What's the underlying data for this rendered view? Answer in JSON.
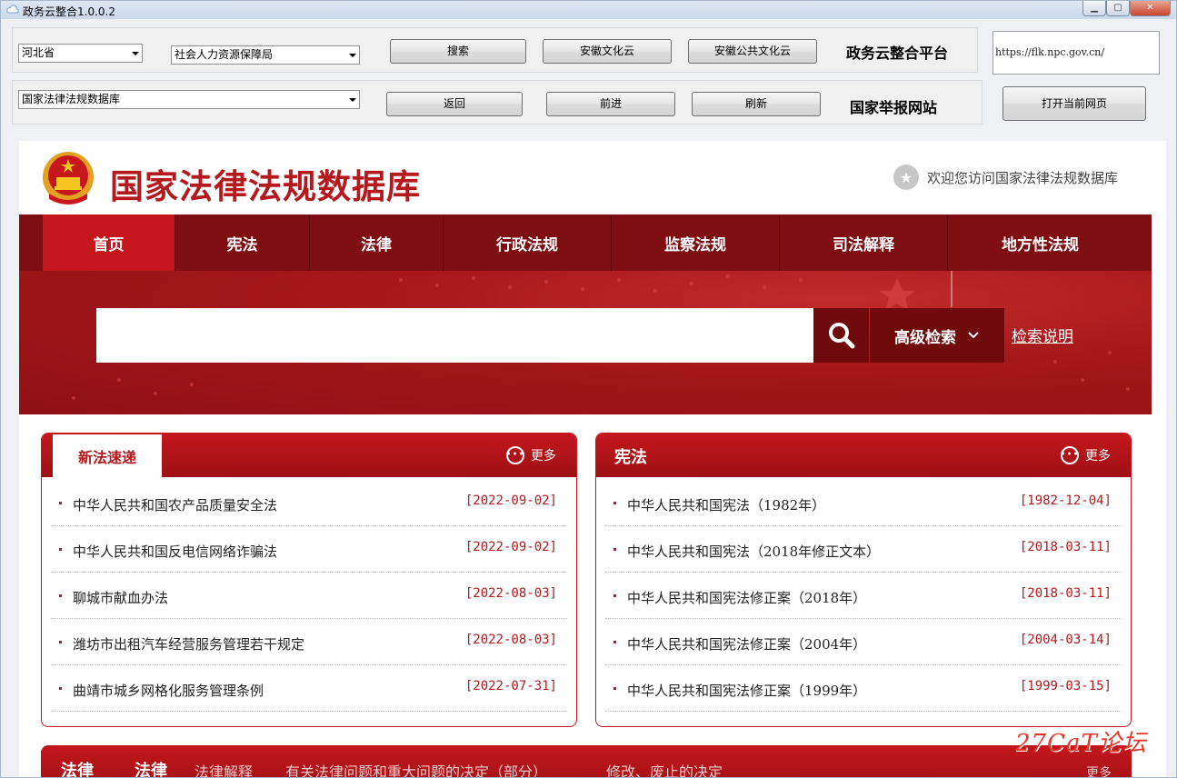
{
  "window": {
    "title": "政务云整合1.0.0.2",
    "buttons": [
      "minimize",
      "maximize",
      "close"
    ]
  },
  "toolbar": {
    "province": "河北省",
    "department": "社会人力资源保障局",
    "site_select": "国家法律法规数据库",
    "search_label": "搜索",
    "anhui_culture_label": "安徽文化云",
    "anhui_public_culture_label": "安徽公共文化云",
    "platform_label": "政务云整合平台",
    "back_label": "返回",
    "forward_label": "前进",
    "refresh_label": "刷新",
    "report_label": "国家举报网站",
    "url": "https://flk.npc.gov.cn/",
    "open_label": "打开当前网页"
  },
  "site": {
    "title": "国家法律法规数据库",
    "welcome": "欢迎您访问国家法律法规数据库",
    "nav": [
      "首页",
      "宪法",
      "法律",
      "行政法规",
      "监察法规",
      "司法解释",
      "地方性法规"
    ],
    "search_placeholder": "",
    "advanced_search": "高级检索",
    "search_help": "检索说明"
  },
  "panels": {
    "new_laws": {
      "title": "新法速递",
      "more": "更多",
      "items": [
        {
          "title": "中华人民共和国农产品质量安全法",
          "date": "[2022-09-02]"
        },
        {
          "title": "中华人民共和国反电信网络诈骗法",
          "date": "[2022-09-02]"
        },
        {
          "title": "聊城市献血办法",
          "date": "[2022-08-03]"
        },
        {
          "title": "潍坊市出租汽车经营服务管理若干规定",
          "date": "[2022-08-03]"
        },
        {
          "title": "曲靖市城乡网格化服务管理条例",
          "date": "[2022-07-31]"
        }
      ]
    },
    "constitution": {
      "title": "宪法",
      "more": "更多",
      "items": [
        {
          "title": "中华人民共和国宪法（1982年）",
          "date": "[1982-12-04]"
        },
        {
          "title": "中华人民共和国宪法（2018年修正文本）",
          "date": "[2018-03-11]"
        },
        {
          "title": "中华人民共和国宪法修正案（2018年）",
          "date": "[2018-03-11]"
        },
        {
          "title": "中华人民共和国宪法修正案（2004年）",
          "date": "[2004-03-14]"
        },
        {
          "title": "中华人民共和国宪法修正案（1999年）",
          "date": "[1999-03-15]"
        }
      ]
    },
    "laws": {
      "title": "法律",
      "tabs": [
        "法律",
        "法律解释",
        "有关法律问题和重大问题的决定（部分）",
        "修改、废止的决定"
      ],
      "more": "更多"
    }
  },
  "watermark": "27CaT论坛"
}
